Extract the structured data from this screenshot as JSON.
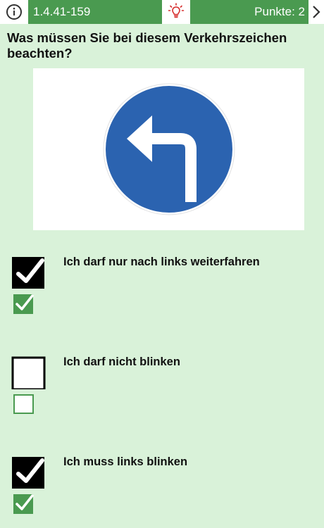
{
  "header": {
    "question_id": "1.4.41-159",
    "score_label": "Punkte: 2",
    "info_icon": "info-circle-icon",
    "hint_icon": "lightbulb-icon",
    "next_icon": "chevron-right-icon"
  },
  "question": {
    "text": "Was müssen Sie bei diesem Verkehrszeichen beachten?"
  },
  "sign": {
    "icon": "mandatory-turn-left-sign",
    "color": "#2b63b0"
  },
  "answers": [
    {
      "label": "Ich darf nur nach links weiterfahren",
      "checked": true,
      "correct": true
    },
    {
      "label": "Ich darf nicht blinken",
      "checked": false,
      "correct": false
    },
    {
      "label": "Ich muss links blinken",
      "checked": true,
      "correct": true
    }
  ],
  "colors": {
    "accent_green": "#4a9a50",
    "background": "#d9f2d9",
    "hint_red": "#d62d2d"
  }
}
